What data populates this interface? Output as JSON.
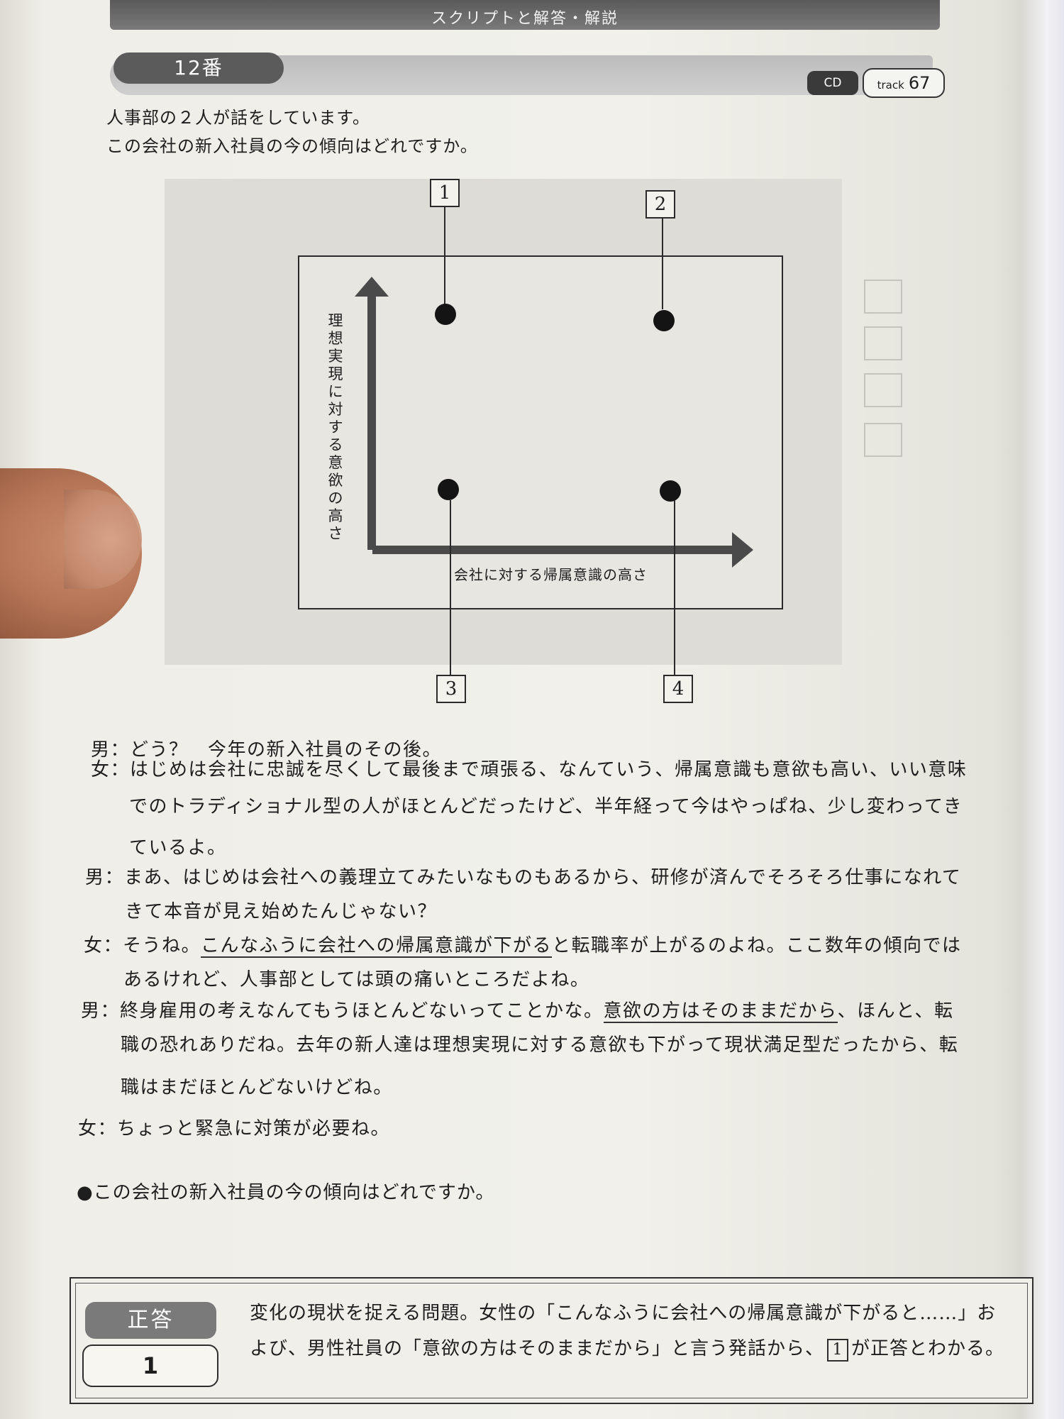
{
  "header": {
    "title": "スクリプトと解答・解説"
  },
  "question_number": "12番",
  "media": {
    "cd_label": "CD",
    "track_label": "track",
    "track_number": "67"
  },
  "intro": {
    "line1": "人事部の２人が話をしています。",
    "line2": "この会社の新入社員の今の傾向はどれですか。"
  },
  "figure": {
    "y_axis_label": "理想実現に対する意欲の高さ",
    "x_axis_label": "会社に対する帰属意識の高さ",
    "choices": [
      "1",
      "2",
      "3",
      "4"
    ]
  },
  "dialogue": {
    "l1": {
      "speaker": "男：",
      "text": "どう？　今年の新入社員のその後。"
    },
    "l2": {
      "speaker": "女：",
      "text": "はじめは会社に忠誠を尽くして最後まで頑張る、なんていう、帰属意識も意欲も高い、いい意味"
    },
    "l3": {
      "text": "でのトラディショナル型の人がほとんどだったけど、半年経って今はやっぱね、少し変わってき"
    },
    "l4": {
      "text": "ているよ。"
    },
    "l5": {
      "speaker": "男：",
      "text": "まあ、はじめは会社への義理立てみたいなものもあるから、研修が済んでそろそろ仕事になれて"
    },
    "l6": {
      "text": "きて本音が見え始めたんじゃない？"
    },
    "l7": {
      "speaker": "女：",
      "pre": "そうね。",
      "underlined": "こんなふうに会社への帰属意識が下がる",
      "post": "と転職率が上がるのよね。ここ数年の傾向では"
    },
    "l8": {
      "text": "あるけれど、人事部としては頭の痛いところだよね。"
    },
    "l9": {
      "speaker": "男：",
      "pre": "終身雇用の考えなんてもうほとんどないってことかな。",
      "underlined": "意欲の方はそのままだから",
      "post": "、ほんと、転"
    },
    "l10": {
      "text": "職の恐れありだね。去年の新人達は理想実現に対する意欲も下がって現状満足型だったから、転"
    },
    "l11": {
      "text": "職はまだほとんどないけどね。"
    },
    "l12": {
      "speaker": "女：",
      "text": "ちょっと緊急に対策が必要ね。"
    }
  },
  "question": "●この会社の新入社員の今の傾向はどれですか。",
  "answer": {
    "label": "正答",
    "number": "1",
    "expl_line1": "変化の現状を捉える問題。女性の「こんなふうに会社への帰属意識が下がると……」お",
    "expl_line2_pre": "よび、男性社員の「意欲の方はそのままだから」と言う発話から、",
    "expl_line2_box": "1",
    "expl_line2_post": "が正答とわかる。"
  }
}
